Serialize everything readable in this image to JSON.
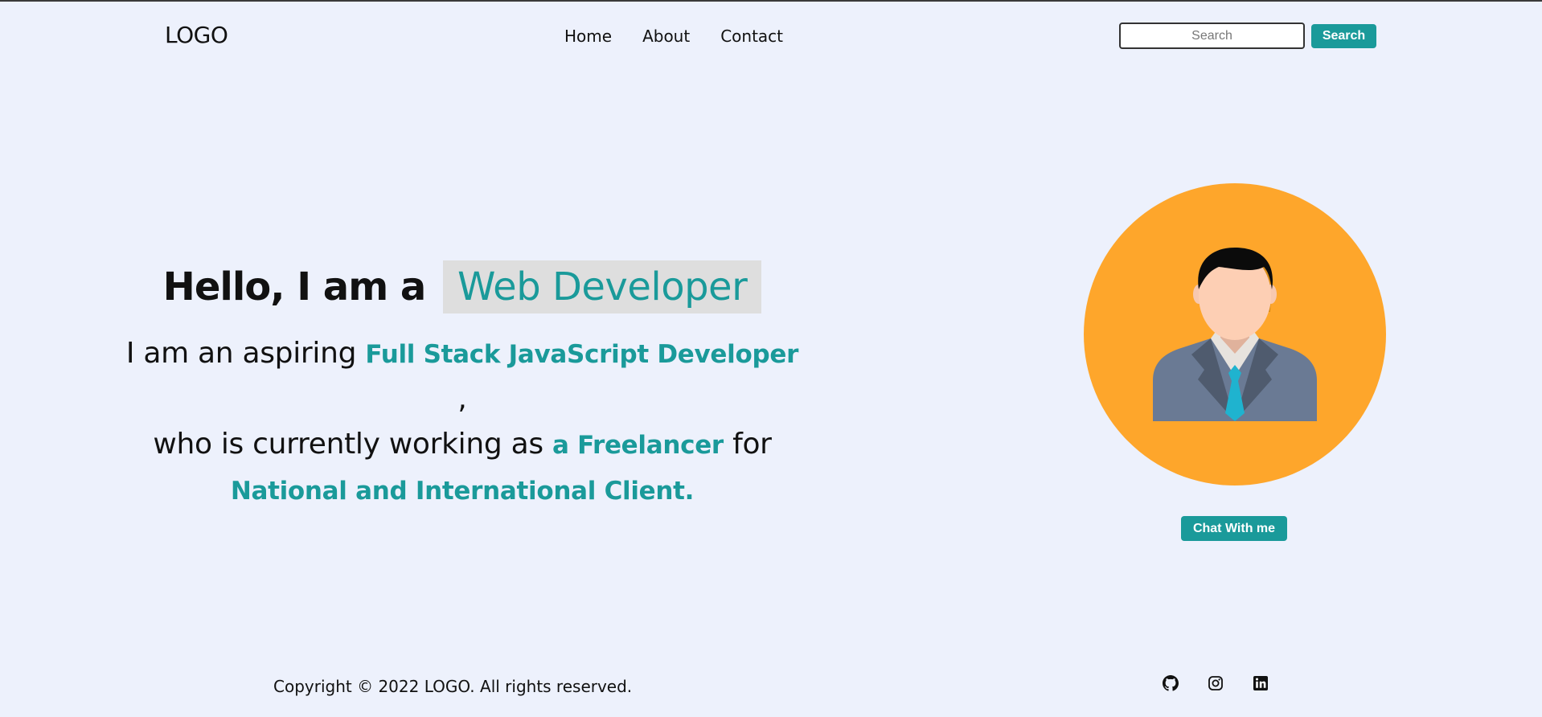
{
  "header": {
    "logo": "LOGO",
    "nav": [
      {
        "label": "Home"
      },
      {
        "label": "About"
      },
      {
        "label": "Contact"
      }
    ],
    "search": {
      "placeholder": "Search",
      "value": "",
      "button_label": "Search"
    }
  },
  "hero": {
    "greeting": "Hello, I am a",
    "role": "Web Developer",
    "line1_prefix": "I am an aspiring",
    "line1_highlight": "Full Stack JavaScript Developer",
    "line1_suffix": ",",
    "line2_prefix": "who is currently working as",
    "line2_highlight": "a Freelancer",
    "line2_suffix": "for",
    "line3_highlight": "National and International Client."
  },
  "profile": {
    "avatar_icon": "businessman-avatar-icon",
    "chat_button_label": "Chat With me"
  },
  "footer": {
    "copyright": "Copyright © 2022 LOGO. All rights reserved.",
    "social_icons": [
      "github-icon",
      "instagram-icon",
      "linkedin-icon"
    ]
  },
  "colors": {
    "background": "#edf1fc",
    "accent": "#1a9a9a",
    "avatar_bg": "#fea62b",
    "role_highlight_bg": "#dedede"
  }
}
